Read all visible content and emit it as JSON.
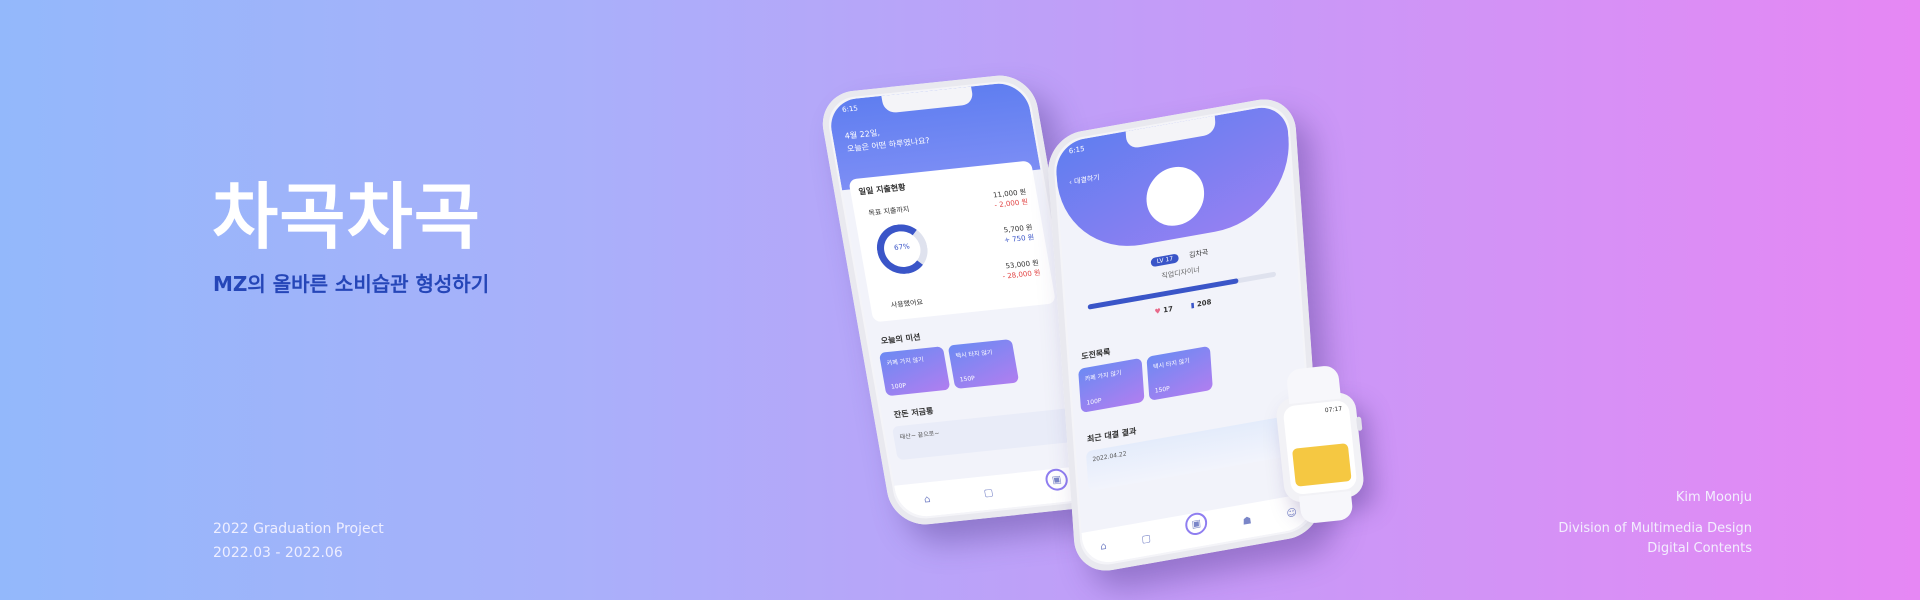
{
  "hero": {
    "title": "차곡차곡",
    "subtitle": "MZ의 올바른 소비습관 형성하기"
  },
  "project": {
    "line1": "2022 Graduation Project",
    "line2": "2022.03 - 2022.06"
  },
  "author": {
    "name": "Kim Moonju",
    "dept1": "Division of Multimedia Design",
    "dept2": "Digital Contents"
  },
  "phone1": {
    "time": "6:15",
    "greeting1": "4월 22일,",
    "greeting2": "오늘은 어떤 하루였나요?",
    "card_title": "일일 지출현황",
    "goal_label": "목표 지출까지",
    "donut_pct": "67%",
    "used_label": "사용했어요",
    "amounts": [
      {
        "value": "11,000 원",
        "delta": "- 2,000 원"
      },
      {
        "value": "5,700 원",
        "delta": "+ 750 원"
      },
      {
        "value": "53,000 원",
        "delta": "- 28,000 원"
      }
    ],
    "missions_title": "오늘의 미션",
    "missions": [
      {
        "label": "카페 가지 않기",
        "points": "100P"
      },
      {
        "label": "택시 타지 않기",
        "points": "150P"
      }
    ],
    "savings_title": "잔돈 저금통",
    "savings_text": "태산~ 끝으로~"
  },
  "phone2": {
    "time": "6:15",
    "back_label": "대결하기",
    "level": "LV 17",
    "name": "김차곡",
    "job": "직업디자이너",
    "level_progress": 0.8,
    "likes": "17",
    "score": "208",
    "challenge_title": "도전목록",
    "challenges": [
      {
        "label": "카페 가지 않기",
        "points": "100P"
      },
      {
        "label": "택시 타지 않기",
        "points": "150P"
      }
    ],
    "recent_title": "최근 대결 결과",
    "recent_date": "2022.04.22"
  },
  "watch": {
    "time": "07:17"
  },
  "icons": {
    "home": "home-icon",
    "piggy": "piggy-icon",
    "wallet": "wallet-icon",
    "battle": "battle-icon",
    "profile": "profile-icon"
  }
}
